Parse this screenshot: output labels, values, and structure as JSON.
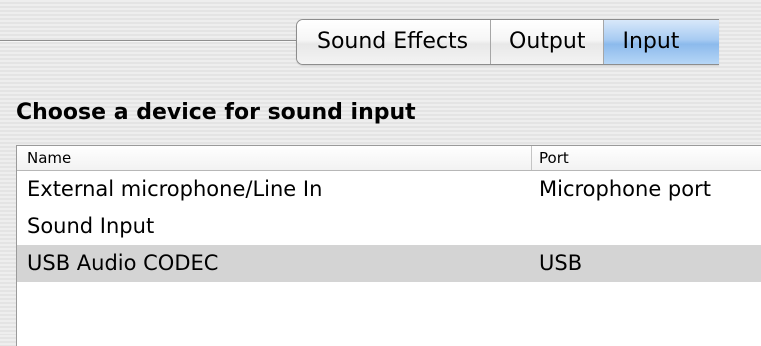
{
  "tabs": [
    {
      "label": "Sound Effects",
      "active": false
    },
    {
      "label": "Output",
      "active": false
    },
    {
      "label": "Input",
      "active": true
    }
  ],
  "section_title": "Choose a device for sound input",
  "table": {
    "columns": [
      "Name",
      "Port"
    ],
    "rows": [
      {
        "name": "External microphone/Line In",
        "port": "Microphone port",
        "selected": false
      },
      {
        "name": "Sound Input",
        "port": "",
        "selected": false
      },
      {
        "name": "USB Audio CODEC",
        "port": "USB",
        "selected": true
      }
    ]
  },
  "colors": {
    "active_tab": "#a7cbf2",
    "selected_row": "#d4d4d4",
    "background": "#ececec"
  }
}
